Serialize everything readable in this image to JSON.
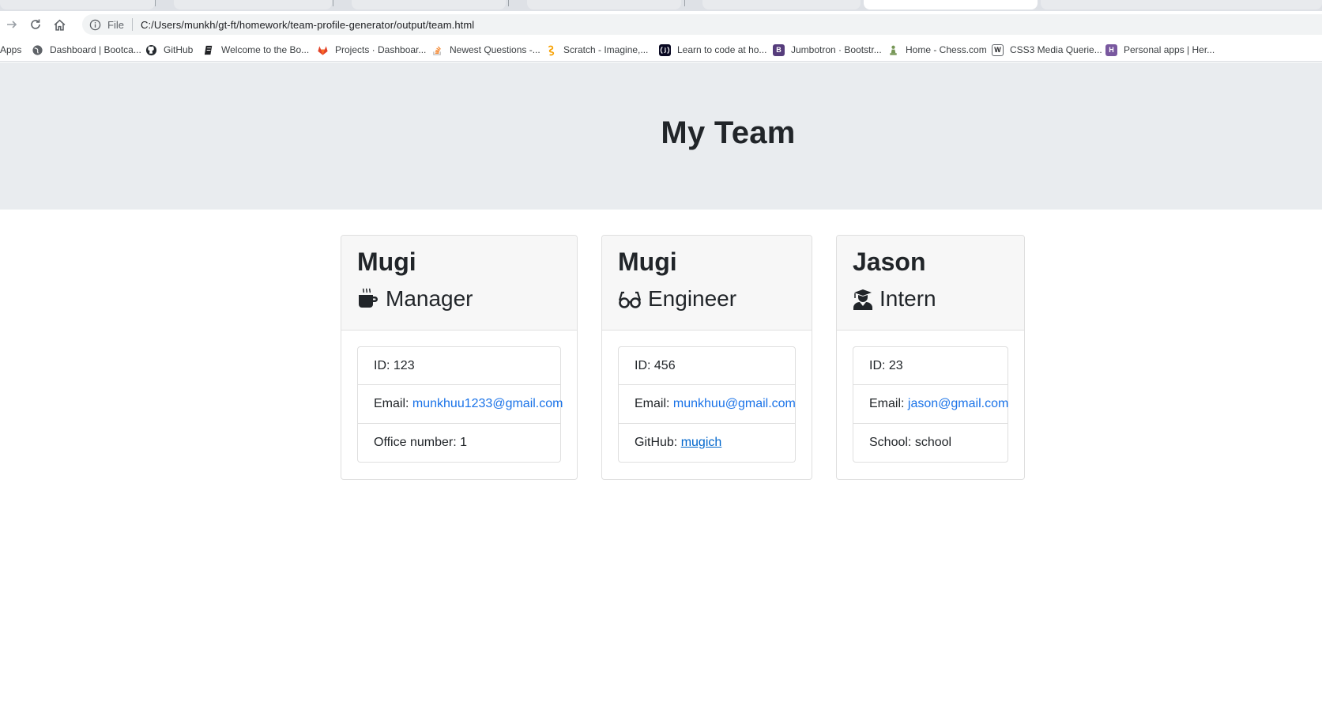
{
  "browser": {
    "address": {
      "scheme_label": "File",
      "url": "C:/Users/munkh/gt-ft/homework/team-profile-generator/output/team.html"
    },
    "bookmarks": [
      {
        "label": "Apps",
        "icon": "apps-icon"
      },
      {
        "label": "Dashboard | Bootca...",
        "icon": "globe-icon"
      },
      {
        "label": "GitHub",
        "icon": "github-icon"
      },
      {
        "label": "Welcome to the Bo...",
        "icon": "book-icon"
      },
      {
        "label": "Projects · Dashboar...",
        "icon": "gitlab-icon"
      },
      {
        "label": "Newest Questions -...",
        "icon": "stackoverflow-icon"
      },
      {
        "label": "Scratch - Imagine,...",
        "icon": "scratch-icon"
      },
      {
        "label": "Learn to code at ho...",
        "icon": "freecodecamp-icon"
      },
      {
        "label": "Jumbotron · Bootstr...",
        "icon": "bootstrap-icon"
      },
      {
        "label": "Home - Chess.com",
        "icon": "chess-icon"
      },
      {
        "label": "CSS3 Media Querie...",
        "icon": "w3-icon"
      },
      {
        "label": "Personal apps | Her...",
        "icon": "heroku-icon"
      }
    ]
  },
  "page": {
    "title": "My Team",
    "team": [
      {
        "name": "Mugi",
        "role": "Manager",
        "role_icon": "coffee-mug-icon",
        "id_label": "ID: 123",
        "email_label": "Email: ",
        "email": "munkhuu1233@gmail.com",
        "extra_label": "Office number: 1"
      },
      {
        "name": "Mugi",
        "role": "Engineer",
        "role_icon": "glasses-icon",
        "id_label": "ID: 456",
        "email_label": "Email: ",
        "email": "munkhuu@gmail.com",
        "extra_label": "GitHub: ",
        "extra_link": "mugich"
      },
      {
        "name": "Jason",
        "role": "Intern",
        "role_icon": "graduate-icon",
        "id_label": "ID: 23",
        "email_label": "Email: ",
        "email": "jason@gmail.com",
        "extra_label": "School: school"
      }
    ]
  },
  "colors": {
    "jumbotron_bg": "#e9ecef",
    "link": "#1a73e8",
    "card_header_bg": "#f7f7f7"
  }
}
